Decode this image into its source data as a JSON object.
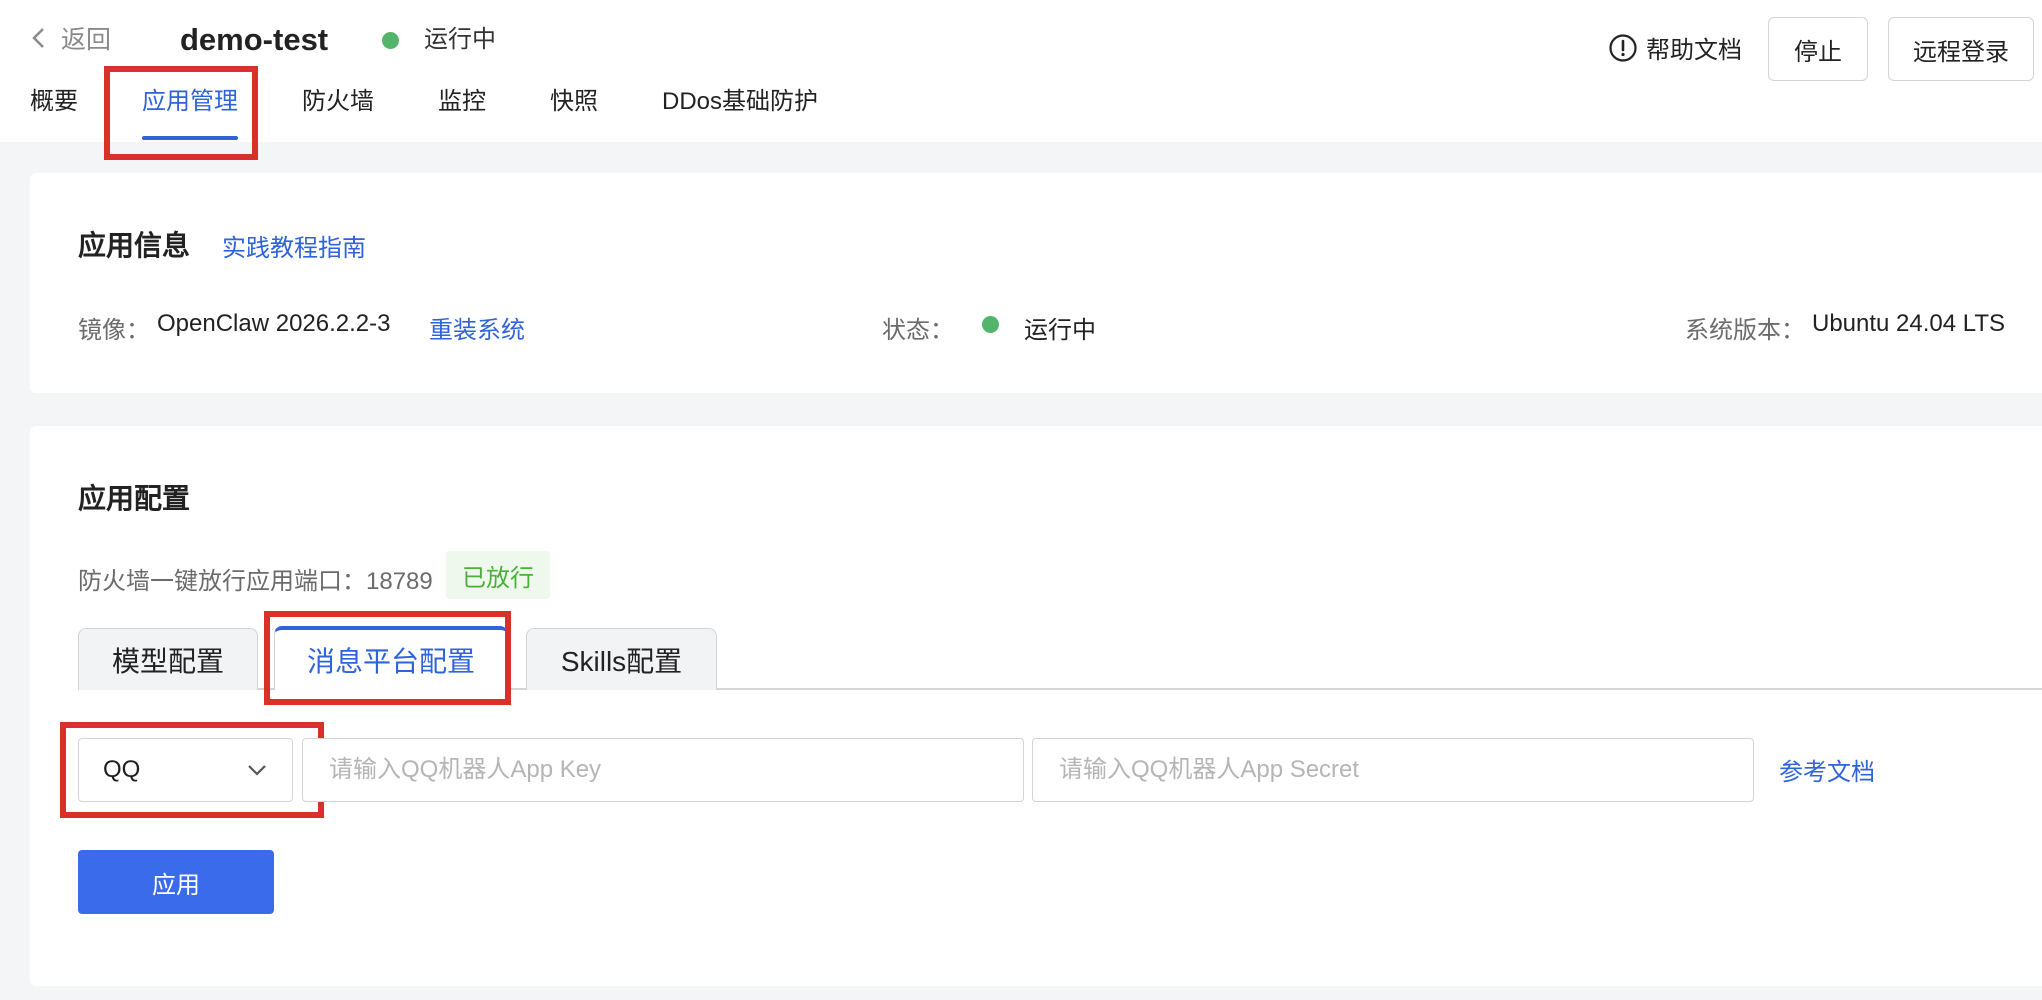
{
  "header": {
    "back_label": "返回",
    "instance_name": "demo-test",
    "status_text": "运行中",
    "help_doc_label": "帮助文档",
    "stop_label": "停止",
    "remote_login_label": "远程登录"
  },
  "nav": {
    "tabs": [
      {
        "label": "概要"
      },
      {
        "label": "应用管理",
        "active": true
      },
      {
        "label": "防火墙"
      },
      {
        "label": "监控"
      },
      {
        "label": "快照"
      },
      {
        "label": "DDos基础防护"
      }
    ]
  },
  "app_info": {
    "title": "应用信息",
    "guide_link": "实践教程指南",
    "image_label": "镜像：",
    "image_value": "OpenClaw 2026.2.2-3",
    "reinstall_link": "重装系统",
    "status_label": "状态：",
    "status_value": "运行中",
    "os_label": "系统版本：",
    "os_value": "Ubuntu 24.04 LTS"
  },
  "app_config": {
    "title": "应用配置",
    "firewall_text": "防火墙一键放行应用端口：18789",
    "released_tag": "已放行",
    "subtabs": [
      {
        "label": "模型配置"
      },
      {
        "label": "消息平台配置",
        "active": true
      },
      {
        "label": "Skills配置"
      }
    ],
    "platform_select": "QQ",
    "app_key_placeholder": "请输入QQ机器人App Key",
    "app_secret_placeholder": "请输入QQ机器人App Secret",
    "ref_doc_link": "参考文档",
    "apply_label": "应用"
  },
  "colors": {
    "accent": "#2f63d9",
    "primary_button": "#3a6bea",
    "status_green": "#52b56b",
    "annotation_red": "#d9302a"
  },
  "icons": [
    "chevron-left-icon",
    "status-dot-icon",
    "info-circle-icon",
    "chevron-down-icon"
  ]
}
